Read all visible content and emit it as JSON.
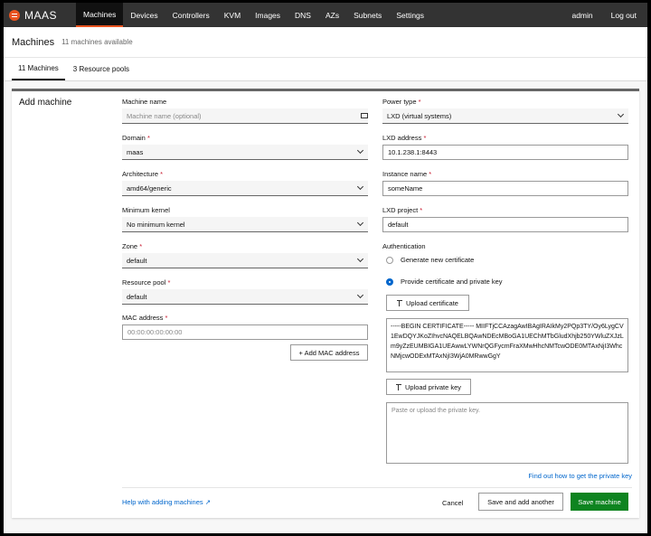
{
  "app": {
    "logo_text": "MAAS",
    "brand_color": "#e95420",
    "primary_color": "#0e8420",
    "link_color": "#0066cc"
  },
  "nav": {
    "items": [
      {
        "label": "Machines"
      },
      {
        "label": "Devices"
      },
      {
        "label": "Controllers"
      },
      {
        "label": "KVM"
      },
      {
        "label": "Images"
      },
      {
        "label": "DNS"
      },
      {
        "label": "AZs"
      },
      {
        "label": "Subnets"
      },
      {
        "label": "Settings"
      }
    ],
    "user": "admin",
    "logout": "Log out"
  },
  "header": {
    "title": "Machines",
    "subtitle": "11 machines available"
  },
  "tabs": [
    {
      "label": "11 Machines"
    },
    {
      "label": "3 Resource pools"
    }
  ],
  "form": {
    "title": "Add machine",
    "machine_name": {
      "label": "Machine name",
      "placeholder": "Machine name (optional)"
    },
    "domain": {
      "label": "Domain",
      "value": "maas"
    },
    "architecture": {
      "label": "Architecture",
      "value": "amd64/generic"
    },
    "minimum_kernel": {
      "label": "Minimum kernel",
      "value": "No minimum kernel"
    },
    "zone": {
      "label": "Zone",
      "value": "default"
    },
    "resource_pool": {
      "label": "Resource pool",
      "value": "default"
    },
    "mac_address": {
      "label": "MAC address",
      "placeholder": "00:00:00:00:00:00"
    },
    "add_mac": "+ Add MAC address",
    "power_type": {
      "label": "Power type",
      "value": "LXD (virtual systems)"
    },
    "lxd_address": {
      "label": "LXD address",
      "value": "10.1.238.1:8443"
    },
    "instance_name": {
      "label": "Instance name",
      "value": "someName"
    },
    "lxd_project": {
      "label": "LXD project",
      "value": "default"
    },
    "authentication": {
      "label": "Authentication",
      "option_generate": "Generate new certificate",
      "option_provide": "Provide certificate and private key"
    },
    "upload_certificate": "Upload certificate",
    "certificate_text": "-----BEGIN CERTIFICATE----- MIIFTjCCAzagAwIBAgIRAIkMy2PQp3TY/Oy6LygCV1EwDQYJKoZIhvcNAQELBQAwNDEcMBoGA1UEChMTbGludXhjb250YWluZXJzLm9yZzEUMBIGA1UEAwwLYWNrQGFycmFraXMwHhcNMTcwODE0MTAxNjI3WhcNMjcwODExMTAxNjI3WjA0MRwwGgY",
    "upload_private_key": "Upload private key",
    "private_key_placeholder": "Paste or  upload the private key.",
    "find_out_link": "Find out how to get the private key"
  },
  "footer": {
    "help_link": "Help with adding machines",
    "cancel": "Cancel",
    "save_add_another": "Save and add another",
    "save_machine": "Save machine"
  }
}
